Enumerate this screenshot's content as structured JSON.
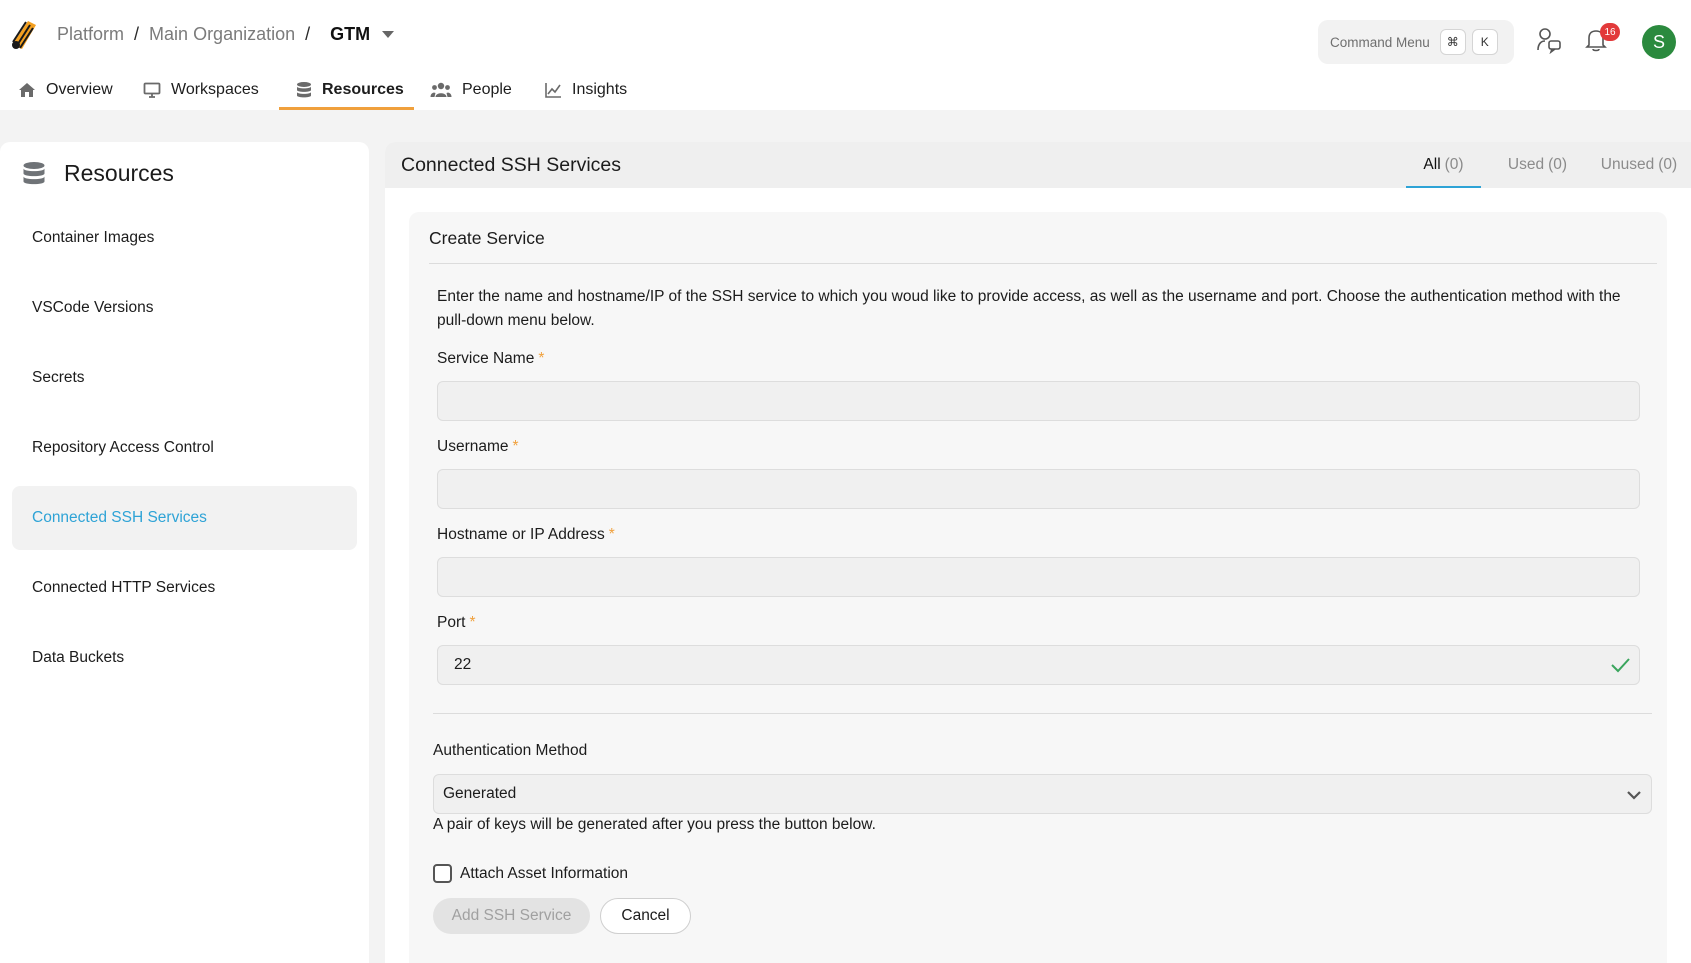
{
  "breadcrumb": {
    "items": [
      "Platform",
      "Main Organization"
    ],
    "current": "GTM"
  },
  "command_menu": {
    "label": "Command Menu",
    "keys": [
      "⌘",
      "K"
    ]
  },
  "notifications": {
    "count": "16"
  },
  "user": {
    "initial": "S"
  },
  "nav": {
    "items": [
      {
        "label": "Overview",
        "icon": "home-icon"
      },
      {
        "label": "Workspaces",
        "icon": "monitor-icon"
      },
      {
        "label": "Resources",
        "icon": "database-icon",
        "active": true
      },
      {
        "label": "People",
        "icon": "people-icon"
      },
      {
        "label": "Insights",
        "icon": "chart-line-icon"
      }
    ]
  },
  "sidebar": {
    "title": "Resources",
    "items": [
      {
        "label": "Container Images"
      },
      {
        "label": "VSCode Versions"
      },
      {
        "label": "Secrets"
      },
      {
        "label": "Repository Access Control"
      },
      {
        "label": "Connected SSH Services",
        "active": true
      },
      {
        "label": "Connected HTTP Services"
      },
      {
        "label": "Data Buckets"
      }
    ]
  },
  "main": {
    "title": "Connected SSH Services",
    "tabs": [
      {
        "label": "All",
        "count": "(0)",
        "active": true
      },
      {
        "label": "Used",
        "count": "(0)"
      },
      {
        "label": "Unused",
        "count": "(0)"
      }
    ]
  },
  "form": {
    "title": "Create Service",
    "description": "Enter the name and hostname/IP of the SSH service to which you woud like to provide access, as well as the username and port. Choose the authentication method with the pull-down menu below.",
    "required_mark": "*",
    "fields": {
      "service_name": {
        "label": "Service Name",
        "value": ""
      },
      "username": {
        "label": "Username",
        "value": ""
      },
      "hostname": {
        "label": "Hostname or IP Address",
        "value": ""
      },
      "port": {
        "label": "Port",
        "value": "22"
      }
    },
    "auth": {
      "label": "Authentication Method",
      "selected": "Generated",
      "hint": "A pair of keys will be generated after you press the button below."
    },
    "attach_asset_label": "Attach Asset Information",
    "submit_label": "Add SSH Service",
    "cancel_label": "Cancel"
  },
  "colors": {
    "accent_orange": "#f0a03c",
    "active_blue": "#2ea3d6",
    "badge_red": "#e2393a",
    "avatar_green": "#2b8a3e",
    "valid_green": "#3aa55d"
  }
}
